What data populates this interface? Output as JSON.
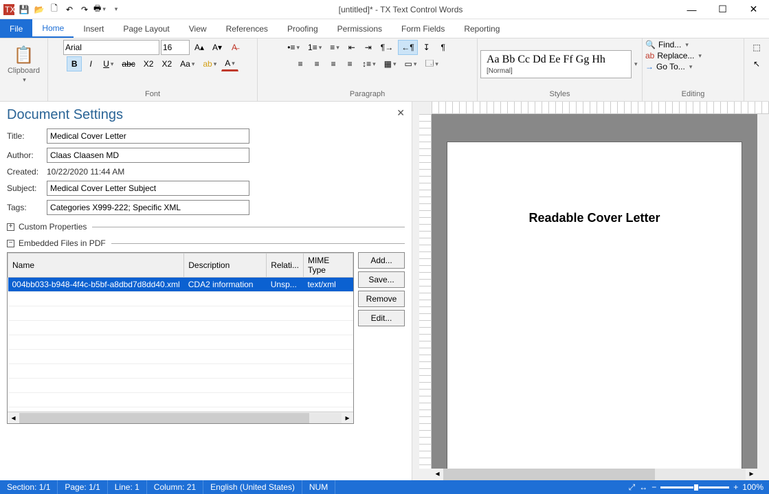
{
  "window": {
    "title": "[untitled]* - TX Text Control Words"
  },
  "menu": {
    "file": "File",
    "tabs": [
      "Home",
      "Insert",
      "Page Layout",
      "View",
      "References",
      "Proofing",
      "Permissions",
      "Form Fields",
      "Reporting"
    ],
    "active": "Home"
  },
  "ribbon": {
    "clipboard": {
      "label": "Clipboard"
    },
    "font": {
      "label": "Font",
      "name": "Arial",
      "size": "16"
    },
    "paragraph": {
      "label": "Paragraph"
    },
    "styles": {
      "label": "Styles",
      "preview_big": "Aa Bb Cc Dd Ee Ff Gg Hh",
      "preview_small": "[Normal]"
    },
    "editing": {
      "label": "Editing",
      "find": "Find...",
      "replace": "Replace...",
      "goto": "Go To..."
    }
  },
  "panel": {
    "title": "Document Settings",
    "labels": {
      "title": "Title:",
      "author": "Author:",
      "created": "Created:",
      "subject": "Subject:",
      "tags": "Tags:"
    },
    "values": {
      "title": "Medical Cover Letter",
      "author": "Claas Claasen MD",
      "created": "10/22/2020 11:44 AM",
      "subject": "Medical Cover Letter Subject",
      "tags": "Categories X999-222; Specific XML"
    },
    "sec_custom": "Custom Properties",
    "sec_embedded": "Embedded Files in PDF",
    "grid": {
      "headers": [
        "Name",
        "Description",
        "Relati...",
        "MIME Type"
      ],
      "row": {
        "name": "004bb033-b948-4f4c-b5bf-a8dbd7d8dd40.xml",
        "desc": "CDA2 information",
        "rel": "Unsp...",
        "mime": "text/xml"
      }
    },
    "buttons": {
      "add": "Add...",
      "save": "Save...",
      "remove": "Remove",
      "edit": "Edit..."
    }
  },
  "document": {
    "heading": "Readable Cover Letter"
  },
  "status": {
    "section": "Section: 1/1",
    "page": "Page: 1/1",
    "line": "Line: 1",
    "column": "Column: 21",
    "lang": "English (United States)",
    "num": "NUM",
    "zoom": "100%"
  }
}
